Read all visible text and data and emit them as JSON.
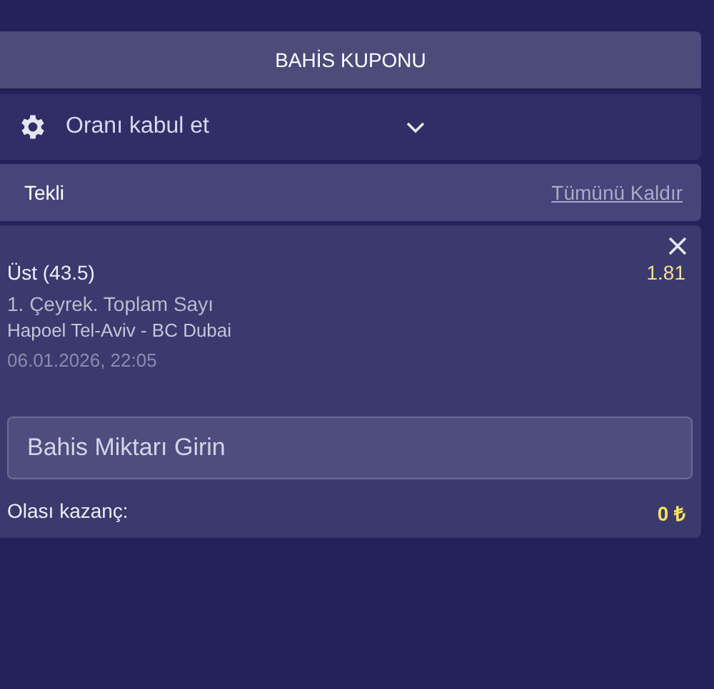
{
  "header": {
    "title": "BAHİS KUPONU"
  },
  "odds_setting": {
    "label": "Oranı kabul et",
    "expanded": false
  },
  "bet_type": {
    "label": "Tekli",
    "action": "Tümünü Kaldır"
  },
  "selections": [
    {
      "pick": "Üst (43.5)",
      "odds": "1.81",
      "market": "1. Çeyrek. Toplam Sayı",
      "match": "Hapoel Tel-Aviv - BC Dubai",
      "datetime": "06.01.2026, 22:05"
    }
  ],
  "stake": {
    "placeholder": "Bahis Miktarı Girin"
  },
  "potential_win": {
    "label": "Olası kazanç:",
    "value": "0 ₺"
  }
}
